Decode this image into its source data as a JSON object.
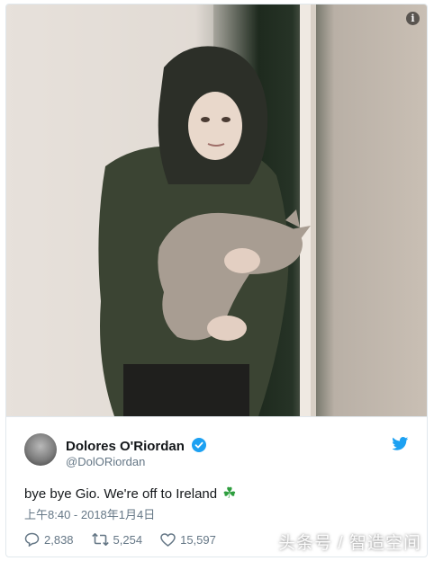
{
  "photo": {
    "info_icon": "info-icon"
  },
  "tweet": {
    "display_name": "Dolores O'Riordan",
    "handle": "@DolORiordan",
    "text": "bye bye Gio. We're off to Ireland",
    "emoji": "☘",
    "timestamp": "上午8:40 - 2018年1月4日",
    "replies": "2,838",
    "retweets": "5,254",
    "likes": "15,597"
  },
  "watermark": "头条号 / 智造空间",
  "colors": {
    "accent": "#1da1f2",
    "muted": "#657786",
    "text": "#14171a",
    "clover": "#2e9e3e"
  }
}
